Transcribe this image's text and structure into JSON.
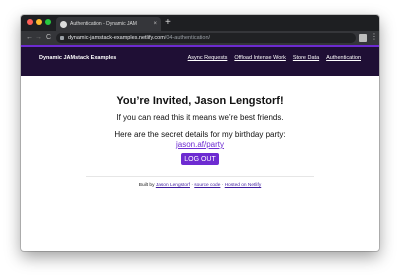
{
  "browser": {
    "tab_title": "Authentication - Dynamic JAM",
    "tab_close": "×",
    "new_tab": "+",
    "url_host": "dynamic-jamstack-examples.netlify.com",
    "url_path": "/04-authentication/",
    "back_icon": "←",
    "forward_icon": "→",
    "reload_icon": "C",
    "menu_icon": "⋮"
  },
  "header": {
    "site_name": "Dynamic JAMstack Examples",
    "nav": [
      "Async Requests",
      "Offload Intense Work",
      "Store Data",
      "Authentication"
    ]
  },
  "main": {
    "title": "You’re Invited, Jason Lengstorf!",
    "intro": "If you can read this it means we’re best friends.",
    "secret_text": "Here are the secret details for my birthday party:",
    "secret_link": "jason.af/party",
    "logout_label": "LOG OUT"
  },
  "footer": {
    "prefix": "Built by",
    "author_link": "Jason Lengstorf",
    "sep1": "·",
    "source_link": "source code",
    "sep2": "·",
    "hosting_link": "Hosted on Netlify"
  }
}
